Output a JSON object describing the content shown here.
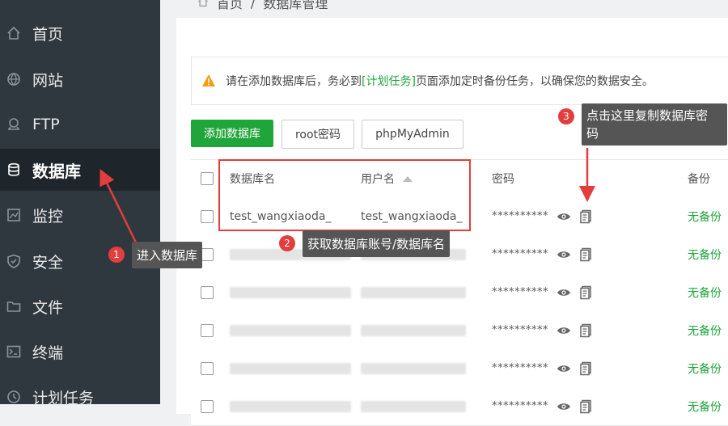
{
  "breadcrumb": {
    "home": "首页",
    "sep": "/",
    "current": "数据库管理"
  },
  "sidebar": {
    "items": [
      {
        "label": "首页",
        "icon": "home-icon"
      },
      {
        "label": "网站",
        "icon": "globe-icon"
      },
      {
        "label": "FTP",
        "icon": "ftp-icon"
      },
      {
        "label": "数据库",
        "icon": "database-icon"
      },
      {
        "label": "监控",
        "icon": "monitor-icon"
      },
      {
        "label": "安全",
        "icon": "shield-icon"
      },
      {
        "label": "文件",
        "icon": "folder-icon"
      },
      {
        "label": "终端",
        "icon": "terminal-icon"
      },
      {
        "label": "计划任务",
        "icon": "clock-icon"
      }
    ]
  },
  "notice": {
    "before": "请在添加数据库后，务必到",
    "link": "[计划任务]",
    "after": "页面添加定时备份任务，以确保您的数据安全。"
  },
  "toolbar": {
    "add": "添加数据库",
    "root": "root密码",
    "pma": "phpMyAdmin"
  },
  "table": {
    "headers": {
      "db_name": "数据库名",
      "username": "用户名",
      "password": "密码",
      "backup": "备份"
    },
    "rows": [
      {
        "db_name": "test_wangxiaoda_",
        "username": "test_wangxiaoda_",
        "password": "**********",
        "backup": "无备份"
      },
      {
        "db_name": "",
        "username": "",
        "password": "**********",
        "backup": "无备份"
      },
      {
        "db_name": "",
        "username": "",
        "password": "**********",
        "backup": "无备份"
      },
      {
        "db_name": "",
        "username": "",
        "password": "**********",
        "backup": "无备份"
      },
      {
        "db_name": "",
        "username": "",
        "password": "**********",
        "backup": "无备份"
      },
      {
        "db_name": "",
        "username": "",
        "password": "**********",
        "backup": "无备份"
      }
    ]
  },
  "annotations": {
    "step1": {
      "num": "1",
      "text": "进入数据库"
    },
    "step2": {
      "num": "2",
      "text": "获取数据库账号/数据库名"
    },
    "step3": {
      "num": "3",
      "text_line1": "点击这里复制数据库密",
      "text_line2": "码"
    }
  },
  "colors": {
    "accent": "#20a53a",
    "annotation": "#e33d3d",
    "sidebar": "#30383f"
  }
}
